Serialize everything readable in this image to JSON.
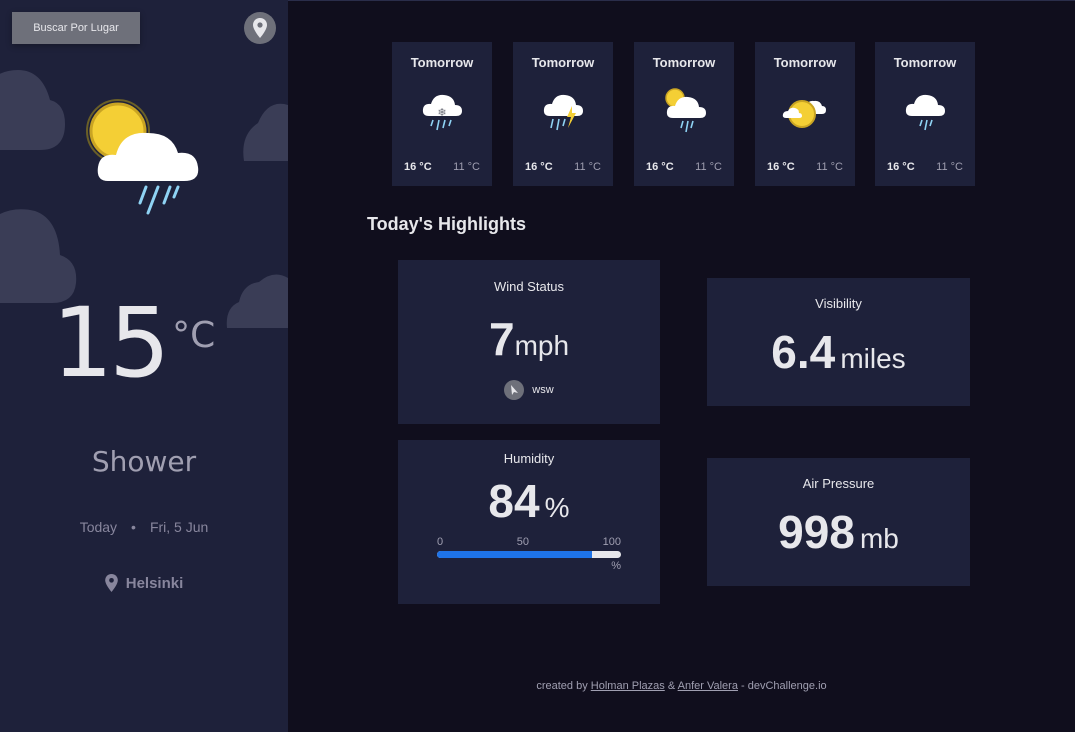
{
  "sidebar": {
    "search_label": "Buscar Por Lugar",
    "location_icon": "location-pin-icon",
    "weather_icon": "sun-cloud-rain-icon",
    "temperature": "15",
    "temperature_unit": "°C",
    "condition": "Shower",
    "date_label": "Today",
    "date_separator": "•",
    "date_value": "Fri, 5 Jun",
    "city": "Helsinki"
  },
  "forecast": [
    {
      "day": "Tomorrow",
      "icon": "sleet-icon",
      "max": "16 °C",
      "min": "11 °C"
    },
    {
      "day": "Tomorrow",
      "icon": "thunderstorm-icon",
      "max": "16 °C",
      "min": "11 °C"
    },
    {
      "day": "Tomorrow",
      "icon": "shower-icon",
      "max": "16 °C",
      "min": "11 °C"
    },
    {
      "day": "Tomorrow",
      "icon": "light-cloud-icon",
      "max": "16 °C",
      "min": "11 °C"
    },
    {
      "day": "Tomorrow",
      "icon": "light-rain-icon",
      "max": "16 °C",
      "min": "11 °C"
    }
  ],
  "highlights": {
    "title": "Today's Highlights",
    "wind": {
      "label": "Wind Status",
      "value": "7",
      "unit": "mph",
      "direction": "wsw",
      "direction_icon": "navigation-arrow-icon"
    },
    "visibility": {
      "label": "Visibility",
      "value": "6.4",
      "unit": "miles"
    },
    "humidity": {
      "label": "Humidity",
      "value": "84",
      "unit": "%",
      "scale_0": "0",
      "scale_50": "50",
      "scale_100": "100",
      "scale_unit": "%",
      "percent": 84
    },
    "pressure": {
      "label": "Air Pressure",
      "value": "998",
      "unit": "mb"
    }
  },
  "footer": {
    "prefix": "created by",
    "author1": "Holman Plazas",
    "amp": "&",
    "author2": "Anfer Valera",
    "suffix": "- devChallenge.io"
  },
  "colors": {
    "sidebar_bg": "#1e213a",
    "main_bg": "#100e1d",
    "card_bg": "#1e213a",
    "accent_blue": "#1e73e8",
    "button_gray": "#6e707a"
  }
}
